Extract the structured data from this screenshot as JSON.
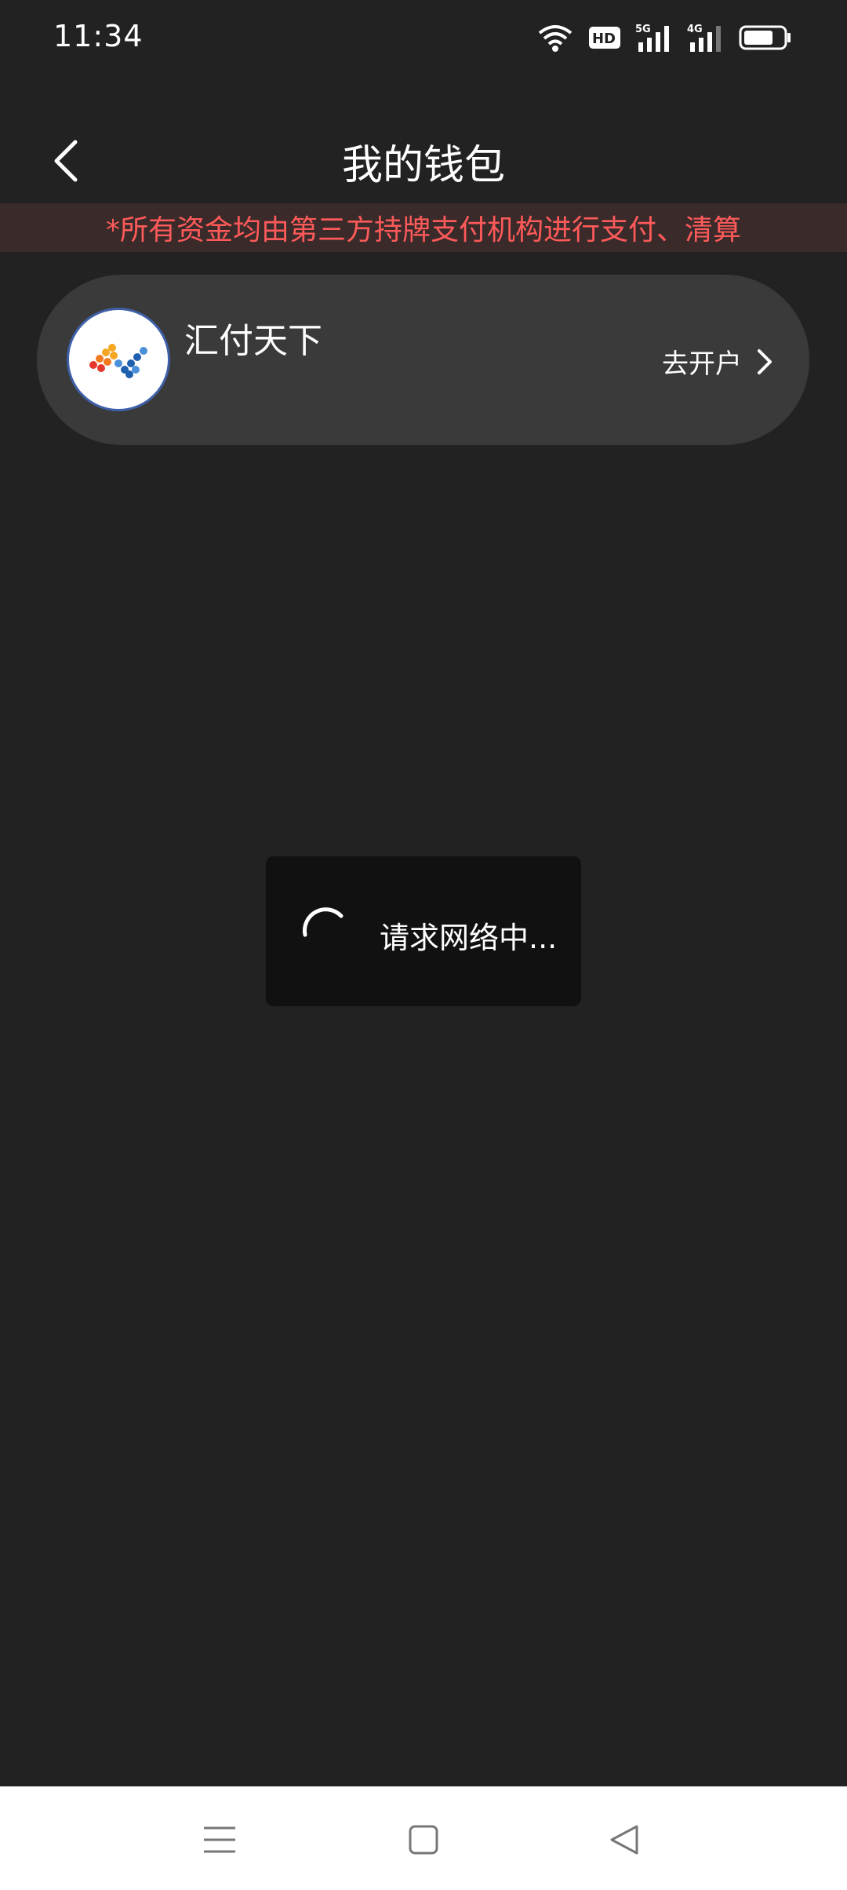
{
  "status_bar": {
    "time": "11:34",
    "icons": [
      "wifi-icon",
      "hd-icon",
      "5g-signal-icon",
      "4g-signal-icon",
      "battery-icon"
    ],
    "hd_label": "HD",
    "net_5g": "5G",
    "net_4g": "4G"
  },
  "header": {
    "title": "我的钱包",
    "back_icon": "chevron-left-icon"
  },
  "notice": {
    "text": "*所有资金均由第三方持牌支付机构进行支付、清算",
    "color": "#ff5a5a"
  },
  "wallet": {
    "provider_name": "汇付天下",
    "action_label": "去开户",
    "action_icon": "chevron-right-icon"
  },
  "loading": {
    "text": "请求网络中..."
  },
  "nav": {
    "menu_icon": "menu-icon",
    "home_icon": "home-square-icon",
    "back_icon": "back-triangle-icon"
  }
}
